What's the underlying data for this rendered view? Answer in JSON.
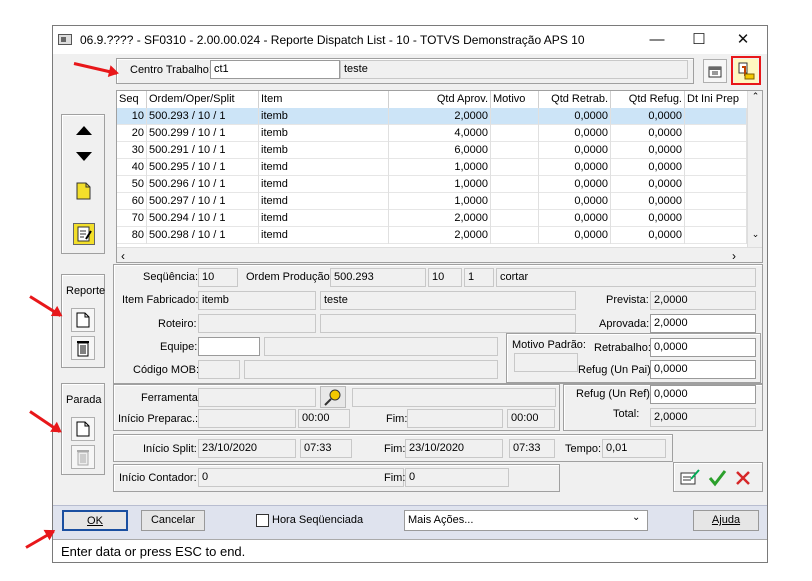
{
  "window": {
    "title": "06.9.???? - SF0310 - 2.00.00.024 - Reporte Dispatch List - 10 - TOTVS Demonstração APS 10"
  },
  "header": {
    "centro_label": "Centro Trabalho:",
    "centro_value": "ct1",
    "centro_desc": "teste"
  },
  "grid": {
    "columns": [
      "Seq",
      "Ordem/Oper/Split",
      "Item",
      "Qtd Aprov.",
      "Motivo",
      "Qtd Retrab.",
      "Qtd Refug.",
      "Dt Ini Prep"
    ],
    "rows": [
      {
        "seq": "10",
        "ordem": "500.293 / 10 / 1",
        "item": "itemb",
        "aprov": "2,0000",
        "motivo": "",
        "retrab": "0,0000",
        "refug": "0,0000"
      },
      {
        "seq": "20",
        "ordem": "500.299 / 10 / 1",
        "item": "itemb",
        "aprov": "4,0000",
        "motivo": "",
        "retrab": "0,0000",
        "refug": "0,0000"
      },
      {
        "seq": "30",
        "ordem": "500.291 / 10 / 1",
        "item": "itemb",
        "aprov": "6,0000",
        "motivo": "",
        "retrab": "0,0000",
        "refug": "0,0000"
      },
      {
        "seq": "40",
        "ordem": "500.295 / 10 / 1",
        "item": "itemd",
        "aprov": "1,0000",
        "motivo": "",
        "retrab": "0,0000",
        "refug": "0,0000"
      },
      {
        "seq": "50",
        "ordem": "500.296 / 10 / 1",
        "item": "itemd",
        "aprov": "1,0000",
        "motivo": "",
        "retrab": "0,0000",
        "refug": "0,0000"
      },
      {
        "seq": "60",
        "ordem": "500.297 / 10 / 1",
        "item": "itemd",
        "aprov": "1,0000",
        "motivo": "",
        "retrab": "0,0000",
        "refug": "0,0000"
      },
      {
        "seq": "70",
        "ordem": "500.294 / 10 / 1",
        "item": "itemd",
        "aprov": "2,0000",
        "motivo": "",
        "retrab": "0,0000",
        "refug": "0,0000"
      },
      {
        "seq": "80",
        "ordem": "500.298 / 10 / 1",
        "item": "itemd",
        "aprov": "2,0000",
        "motivo": "",
        "retrab": "0,0000",
        "refug": "0,0000"
      }
    ]
  },
  "sidebar": {
    "reporte_label": "Reporte",
    "parada_label": "Parada"
  },
  "detail": {
    "sequencia_label": "Seqüência:",
    "sequencia": "10",
    "ordem_label": "Ordem Produção:",
    "ordem": "500.293",
    "oper": "10",
    "split": "1",
    "oper_desc": "cortar",
    "item_label": "Item Fabricado:",
    "item": "itemb",
    "item_desc": "teste",
    "roteiro_label": "Roteiro:",
    "equipe_label": "Equipe:",
    "mob_label": "Código MOB:",
    "prevista_label": "Prevista:",
    "prevista": "2,0000",
    "aprovada_label": "Aprovada:",
    "aprovada": "2,0000",
    "motivo_padrao_label": "Motivo Padrão:",
    "retrabalho_label": "Retrabalho:",
    "retrabalho": "0,0000",
    "refug_pai_label": "Refug (Un Pai):",
    "refug_pai": "0,0000",
    "ferramenta_label": "Ferramenta:",
    "inicio_prep_label": "Início Preparac.:",
    "inicio_prep_time": "00:00",
    "fim_label": "Fim:",
    "fim_prep_time": "00:00",
    "refug_ref_label": "Refug (Un Ref):",
    "refug_ref": "0,0000",
    "total_label": "Total:",
    "total": "2,0000",
    "inicio_split_label": "Início Split:",
    "inicio_split_date": "23/10/2020",
    "inicio_split_time": "07:33",
    "fim_split_date": "23/10/2020",
    "fim_split_time": "07:33",
    "tempo_label": "Tempo:",
    "tempo": "0,01",
    "inicio_contador_label": "Início Contador:",
    "inicio_contador": "0",
    "fim_contador": "0"
  },
  "footer": {
    "ok": "OK",
    "cancelar": "Cancelar",
    "hora_seq": "Hora Seqüenciada",
    "mais_acoes": "Mais Ações...",
    "ajuda": "Ajuda"
  },
  "status": "Enter data or press ESC to end.",
  "colors": {
    "arrow": "#e8171a",
    "highlight": "#e8171a",
    "footer_bg": "#dfe3ee"
  }
}
